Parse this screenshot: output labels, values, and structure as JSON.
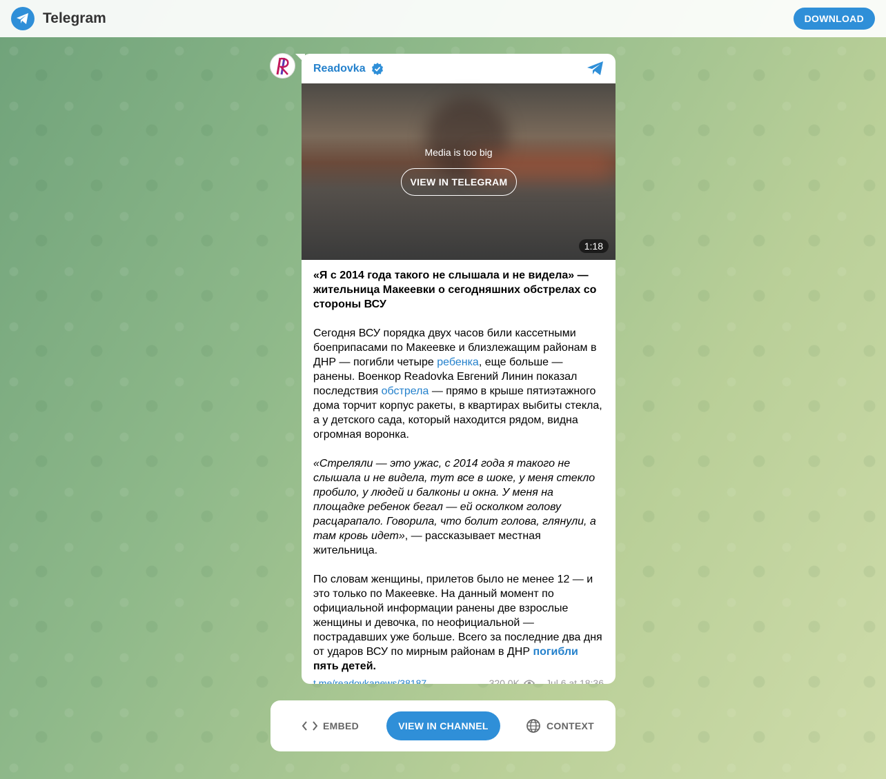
{
  "header": {
    "brand": "Telegram",
    "download_label": "DOWNLOAD"
  },
  "post": {
    "channel_name": "Readovka",
    "media": {
      "notice": "Media is too big",
      "button_label": "VIEW IN TELEGRAM",
      "duration": "1:18"
    },
    "text": {
      "lead": "«Я с 2014 года такого не слышала и не видела» — жительница Макеевки о сегодняшних обстрелах со стороны ВСУ",
      "p2_a": "Сегодня ВСУ порядка двух часов били кассетными боеприпасами по Макеевке и близлежащим районам в ДНР — погибли четыре ",
      "p2_link1": "ребенка",
      "p2_b": ", еще больше — ранены. Военкор Readovka Евгений Линин показал последствия ",
      "p2_link2": "обстрела",
      "p2_c": " — прямо в крыше пятиэтажного дома торчит корпус ракеты, в квартирах выбиты стекла, а у детского сада, который находится рядом, видна огромная воронка.",
      "p3_quote": "«Стреляли — это ужас, с 2014 года я такого не слышала и не видела, тут все в шоке, у меня стекло пробило, у людей и балконы и окна. У меня на площадке ребенок бегал — ей осколком голову расцарапало. Говорила, что болит голова, глянули, а там кровь идет»",
      "p3_rest": ", — рассказывает местная жительница.",
      "p4_a": "По словам женщины, прилетов было не менее 12 — и это только по Макеевке. На данный момент по официальной информации ранены две взрослые женщины и девочка, по неофициальной — пострадавших уже больше. Всего за последние два дня от ударов ВСУ по мирным районам в ДНР ",
      "p4_link": "погибли",
      "p4_bold": " пять детей."
    },
    "footer": {
      "link": "t.me/readovkanews/38187",
      "views": "320.0K",
      "date": "Jul 6 at 18:36"
    }
  },
  "actions": {
    "embed": "EMBED",
    "view_channel": "VIEW IN CHANNEL",
    "context": "CONTEXT"
  },
  "colors": {
    "accent": "#2f8fd8",
    "link": "#2481cc"
  }
}
